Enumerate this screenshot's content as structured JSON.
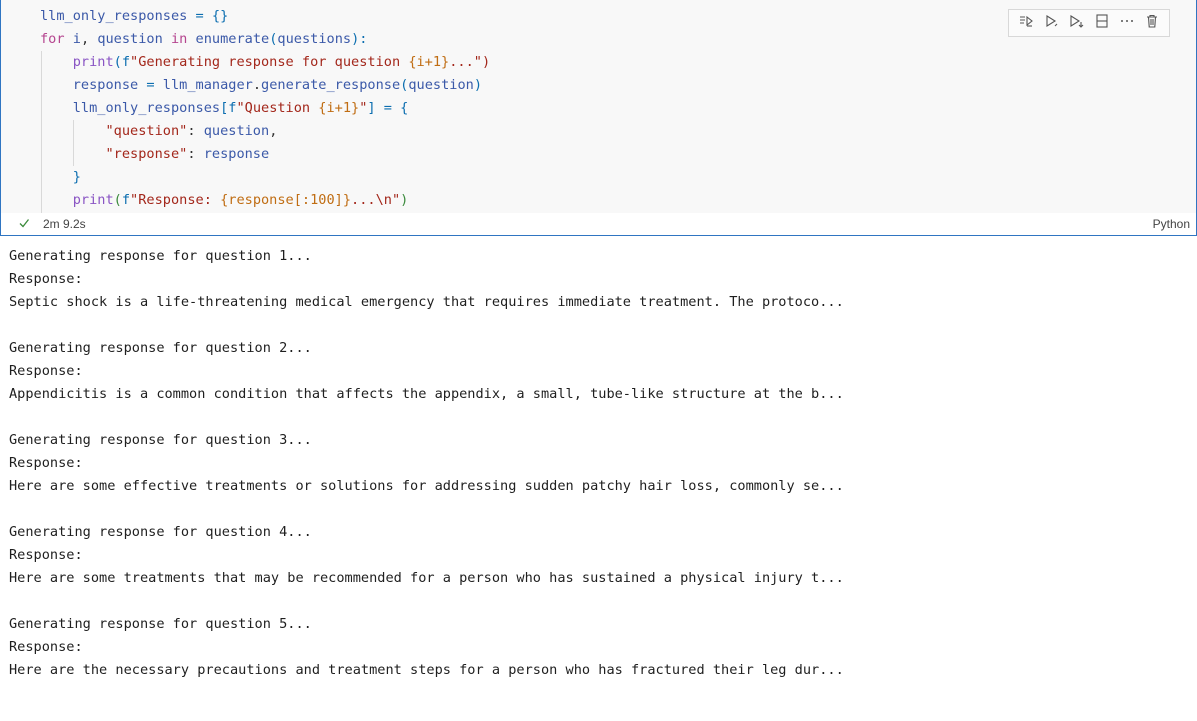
{
  "cell": {
    "code_lines": [
      [
        {
          "t": "llm_only_responses",
          "c": "var"
        },
        {
          "t": " = ",
          "c": "op"
        },
        {
          "t": "{}",
          "c": "brace"
        }
      ],
      [
        {
          "t": "for",
          "c": "kw"
        },
        {
          "t": " ",
          "c": ""
        },
        {
          "t": "i",
          "c": "var"
        },
        {
          "t": ", ",
          "c": ""
        },
        {
          "t": "question",
          "c": "var"
        },
        {
          "t": " ",
          "c": ""
        },
        {
          "t": "in",
          "c": "kw"
        },
        {
          "t": " ",
          "c": ""
        },
        {
          "t": "enumerate",
          "c": "var"
        },
        {
          "t": "(",
          "c": "brace"
        },
        {
          "t": "questions",
          "c": "var"
        },
        {
          "t": "):",
          "c": "brace"
        }
      ],
      [
        {
          "t": "    ",
          "c": ""
        },
        {
          "t": "print",
          "c": "fn"
        },
        {
          "t": "(",
          "c": "brace"
        },
        {
          "t": "f",
          "c": "op"
        },
        {
          "t": "\"Generating response for question ",
          "c": "str"
        },
        {
          "t": "{i+1}",
          "c": "num"
        },
        {
          "t": "...\")",
          "c": "str"
        }
      ],
      [
        {
          "t": "    ",
          "c": ""
        },
        {
          "t": "response",
          "c": "var"
        },
        {
          "t": " = ",
          "c": "op"
        },
        {
          "t": "llm_manager",
          "c": "var"
        },
        {
          "t": ".",
          "c": ""
        },
        {
          "t": "generate_response",
          "c": "var"
        },
        {
          "t": "(",
          "c": "brace"
        },
        {
          "t": "question",
          "c": "var"
        },
        {
          "t": ")",
          "c": "brace"
        }
      ],
      [
        {
          "t": "    ",
          "c": ""
        },
        {
          "t": "llm_only_responses",
          "c": "var"
        },
        {
          "t": "[",
          "c": "brace"
        },
        {
          "t": "f",
          "c": "op"
        },
        {
          "t": "\"Question ",
          "c": "str"
        },
        {
          "t": "{i+1}",
          "c": "num"
        },
        {
          "t": "\"",
          "c": "str"
        },
        {
          "t": "]",
          "c": "brace"
        },
        {
          "t": " = ",
          "c": "op"
        },
        {
          "t": "{",
          "c": "brace"
        }
      ],
      [
        {
          "t": "        ",
          "c": ""
        },
        {
          "t": "\"question\"",
          "c": "str"
        },
        {
          "t": ": ",
          "c": ""
        },
        {
          "t": "question",
          "c": "var"
        },
        {
          "t": ",",
          "c": ""
        }
      ],
      [
        {
          "t": "        ",
          "c": ""
        },
        {
          "t": "\"response\"",
          "c": "str"
        },
        {
          "t": ": ",
          "c": ""
        },
        {
          "t": "response",
          "c": "var"
        }
      ],
      [
        {
          "t": "    ",
          "c": ""
        },
        {
          "t": "}",
          "c": "brace"
        }
      ],
      [
        {
          "t": "    ",
          "c": ""
        },
        {
          "t": "print",
          "c": "fn"
        },
        {
          "t": "(",
          "c": "brace2"
        },
        {
          "t": "f",
          "c": "op"
        },
        {
          "t": "\"Response: ",
          "c": "str"
        },
        {
          "t": "{response[:100]}",
          "c": "num"
        },
        {
          "t": "...\\n\"",
          "c": "str"
        },
        {
          "t": ")",
          "c": "brace2"
        }
      ]
    ],
    "exec_status_icon": "check-icon",
    "exec_time": "2m 9.2s",
    "language": "Python",
    "toolbar": [
      {
        "name": "execute-above-button",
        "icon": "run-above-icon"
      },
      {
        "name": "execute-cell-button",
        "icon": "run-cell-icon"
      },
      {
        "name": "execute-below-button",
        "icon": "run-below-icon"
      },
      {
        "name": "split-cell-button",
        "icon": "split-icon"
      },
      {
        "name": "more-actions-button",
        "icon": "ellipsis-icon"
      },
      {
        "name": "delete-cell-button",
        "icon": "trash-icon"
      }
    ]
  },
  "output": {
    "lines": [
      "Generating response for question 1...",
      "Response:",
      "Septic shock is a life-threatening medical emergency that requires immediate treatment. The protoco...",
      "",
      "Generating response for question 2...",
      "Response:",
      "Appendicitis is a common condition that affects the appendix, a small, tube-like structure at the b...",
      "",
      "Generating response for question 3...",
      "Response:",
      "Here are some effective treatments or solutions for addressing sudden patchy hair loss, commonly se...",
      "",
      "Generating response for question 4...",
      "Response:",
      "Here are some treatments that may be recommended for a person who has sustained a physical injury t...",
      "",
      "Generating response for question 5...",
      "Response:",
      "Here are the necessary precautions and treatment steps for a person who has fractured their leg dur..."
    ]
  }
}
